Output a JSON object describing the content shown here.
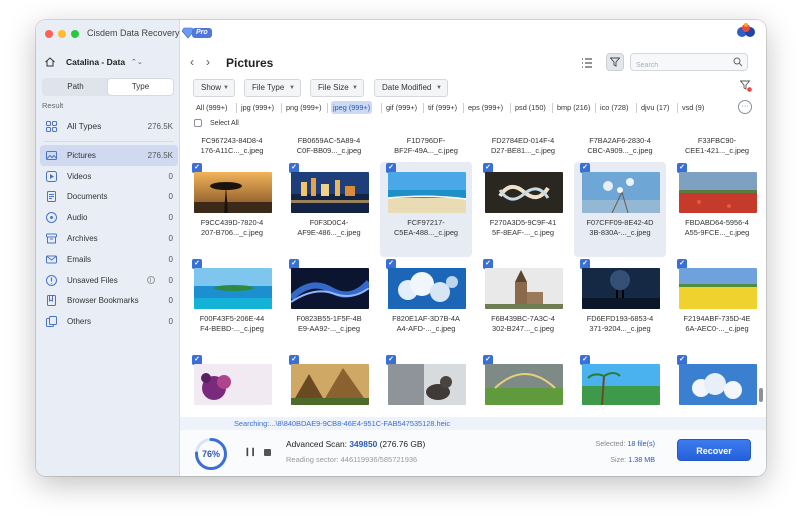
{
  "app": {
    "title": "Cisdem Data Recovery",
    "badge": "Pro"
  },
  "sidebar": {
    "drive": "Catalina - Data",
    "segments": [
      "Path",
      "Type"
    ],
    "active_segment": "Type",
    "result_label": "Result",
    "items": [
      {
        "label": "All Types",
        "count": "276.5K",
        "icon": "grid-icon"
      },
      {
        "label": "Pictures",
        "count": "276.5K",
        "icon": "picture-icon"
      },
      {
        "label": "Videos",
        "count": "0",
        "icon": "video-icon"
      },
      {
        "label": "Documents",
        "count": "0",
        "icon": "document-icon"
      },
      {
        "label": "Audio",
        "count": "0",
        "icon": "audio-icon"
      },
      {
        "label": "Archives",
        "count": "0",
        "icon": "archive-icon"
      },
      {
        "label": "Emails",
        "count": "0",
        "icon": "email-icon"
      },
      {
        "label": "Unsaved Files",
        "count": "0",
        "icon": "unsaved-icon"
      },
      {
        "label": "Browser Bookmarks",
        "count": "0",
        "icon": "bookmark-icon"
      },
      {
        "label": "Others",
        "count": "0",
        "icon": "others-icon"
      }
    ],
    "selected": "Pictures"
  },
  "header": {
    "title": "Pictures",
    "search_placeholder": "Search"
  },
  "filters": [
    "Show",
    "File Type",
    "File Size",
    "Date Modified"
  ],
  "extensions": [
    {
      "label": "All (999+)"
    },
    {
      "label": "jpg (999+)"
    },
    {
      "label": "png (999+)"
    },
    {
      "label": "jpeg (999+)",
      "active": true
    },
    {
      "label": "gif (999+)"
    },
    {
      "label": "tif (999+)"
    },
    {
      "label": "eps (999+)"
    },
    {
      "label": "psd (150)"
    },
    {
      "label": "bmp (216)"
    },
    {
      "label": "ico (728)"
    },
    {
      "label": "djvu (17)"
    },
    {
      "label": "vsd (9)"
    }
  ],
  "select_all_label": "Select All",
  "top_row": [
    [
      "FC967243-84D8-4",
      "176-A11C..._c.jpeg"
    ],
    [
      "FB0659AC-5A89-4",
      "C0F-BB09..._c.jpeg"
    ],
    [
      "F1D796DF-",
      "BF2F-49A..._c.jpeg"
    ],
    [
      "FD2784ED-014F-4",
      "D27-BE81..._c.jpeg"
    ],
    [
      "F7BA2AF6-2830-4",
      "CBC-A909..._c.jpeg"
    ],
    [
      "F33FBC90-",
      "CEE1-421..._c.jpeg"
    ]
  ],
  "rows": [
    [
      {
        "name1": "F9CC439D-7820-4",
        "name2": "207-B706..._c.jpeg",
        "thumb": "sunset-tree"
      },
      {
        "name1": "F0F3D0C4-",
        "name2": "AF9E-486..._c.jpeg",
        "thumb": "city-night"
      },
      {
        "name1": "FCF97217-",
        "name2": "C5EA-488..._c.jpeg",
        "thumb": "beach",
        "highlight": true
      },
      {
        "name1": "F270A3D5-9C9F-41",
        "name2": "5F-8EAF-..._c.jpeg",
        "thumb": "swirl"
      },
      {
        "name1": "F07CFF09-8E42-4D",
        "name2": "3B-830A-..._c.jpeg",
        "thumb": "blossom-sky",
        "highlight": true
      },
      {
        "name1": "FBDABD64-5956-4",
        "name2": "A55-9FCE..._c.jpeg",
        "thumb": "red-field"
      }
    ],
    [
      {
        "name1": "F00F43F5-206E-44",
        "name2": "F4-BEBD-..._c.jpeg",
        "thumb": "ocean-island"
      },
      {
        "name1": "F0823B55-1F5F-4B",
        "name2": "E9-AA92-..._c.jpeg",
        "thumb": "blue-wave"
      },
      {
        "name1": "F820E1AF-3D7B-4A",
        "name2": "A4-AFD-..._c.jpeg",
        "thumb": "blue-clouds"
      },
      {
        "name1": "F6B439BC-7A3C-4",
        "name2": "302-B247..._c.jpeg",
        "thumb": "church"
      },
      {
        "name1": "FD6EFD193-6853-4",
        "name2": "371-9204..._c.jpeg",
        "thumb": "night-couple"
      },
      {
        "name1": "F2194ABF-735D-4E",
        "name2": "6A-AEC0-..._c.jpeg",
        "thumb": "yellow-field"
      }
    ],
    [
      {
        "name1": "",
        "name2": "",
        "thumb": "purple-splash"
      },
      {
        "name1": "",
        "name2": "",
        "thumb": "mountain-valley"
      },
      {
        "name1": "",
        "name2": "",
        "thumb": "cat-window"
      },
      {
        "name1": "",
        "name2": "",
        "thumb": "rainbow-field"
      },
      {
        "name1": "",
        "name2": "",
        "thumb": "palm-beach"
      },
      {
        "name1": "",
        "name2": "",
        "thumb": "sky-clouds"
      }
    ]
  ],
  "status": {
    "searching": "Searching:...\\8\\840BDAE9-9CB8-46E4-951C-FAB547535128.heic",
    "progress_pct": "76%",
    "progress_value": 76,
    "scan_prefix": "Advanced Scan: ",
    "scan_count": "349850",
    "scan_size": " (276.76 GB)",
    "sector": "Reading sector: 446119936/585721936",
    "selected_prefix": "Selected: ",
    "selected_value": "18 file(s)",
    "size_prefix": "Size: ",
    "size_value": "1.38 MB",
    "recover_label": "Recover"
  },
  "colors": {
    "accent": "#3a6fd8",
    "sidebar_bg": "#e8edf6",
    "selected_bg": "#cfdaf0"
  }
}
